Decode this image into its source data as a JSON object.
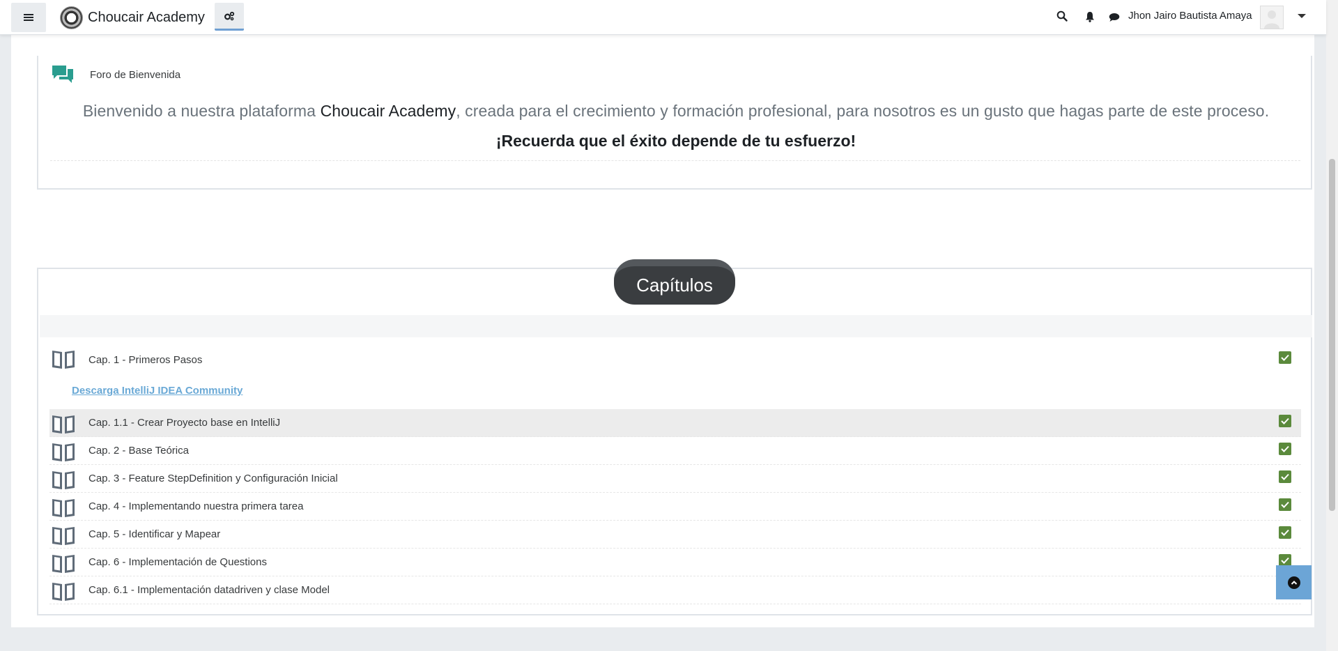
{
  "navbar": {
    "site_name": "Choucair Academy",
    "user_name": "Jhon Jairo Bautista Amaya"
  },
  "welcome": {
    "forum_label": "Foro de Bienvenida",
    "text_before": "Bienvenido a nuestra plataforma ",
    "text_brand": "Choucair Academy",
    "text_after": ", creada para el crecimiento y formación profesional, para nosotros es un gusto que hagas parte de este proceso.",
    "motto": "¡Recuerda que el éxito depende de tu esfuerzo!"
  },
  "section": {
    "title": "Capítulos",
    "first_chapter": "Cap. 1 - Primeros Pasos",
    "download_link": "Descarga IntelliJ IDEA Community",
    "chapters": [
      "Cap. 1.1 - Crear Proyecto base en IntelliJ",
      "Cap. 2 - Base Teórica",
      "Cap. 3 - Feature StepDefinition y Configuración Inicial",
      "Cap. 4 - Implementando nuestra primera tarea",
      "Cap. 5 - Identificar y Mapear",
      "Cap. 6 - Implementación de Questions",
      "Cap. 6.1 - Implementación datadriven y clase Model"
    ]
  },
  "colors": {
    "completion_check": "#5b8a3c",
    "link": "#6aa9d6",
    "forum_icon": "#2a9d8f",
    "section_pill": "#3a3d40"
  }
}
